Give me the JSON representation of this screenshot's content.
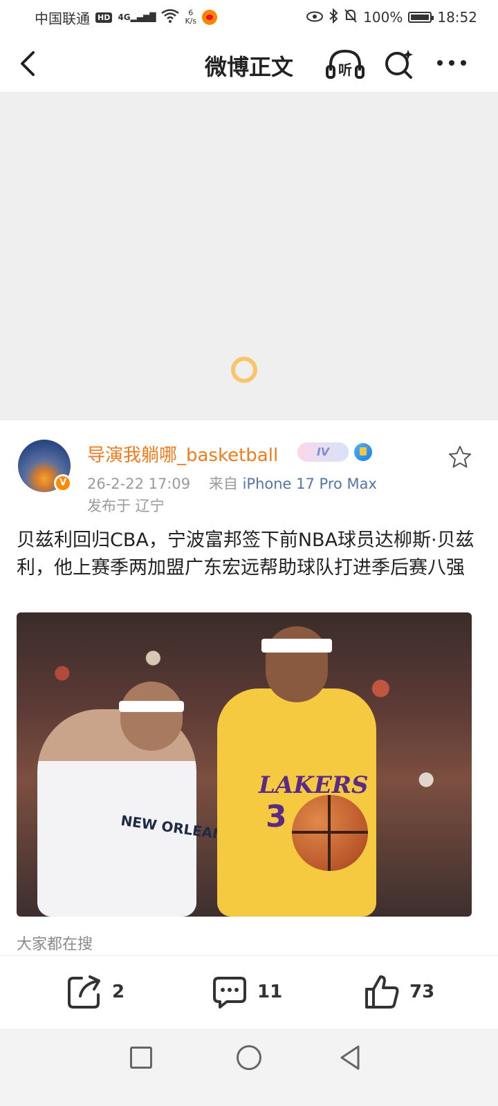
{
  "status_bar": {
    "carrier": "中国联通",
    "hd": "HD",
    "network": "4G",
    "speed_value": "6",
    "speed_unit": "K/s",
    "battery": "100%",
    "time": "18:52"
  },
  "nav": {
    "title": "微博正文",
    "listen_label": "听"
  },
  "post": {
    "username": "导演我躺哪_basketball",
    "level": "IV",
    "verified_badge": "V",
    "timestamp": "26-2-22 17:09",
    "source_prefix": "来自",
    "device": "iPhone 17 Pro Max",
    "location": "发布于 辽宁",
    "content": "贝兹利回归CBA，宁波富邦签下前NBA球员达柳斯·贝兹利，他上赛季两加盟广东宏远帮助球队打进季后赛八强",
    "photo": {
      "jersey_text": "LAKERS",
      "jersey_number": "3",
      "opponent_text": "NEW ORLEANS"
    },
    "search_hint": "大家都在搜"
  },
  "actions": {
    "share_count": "2",
    "comment_count": "11",
    "like_count": "73"
  },
  "colors": {
    "username": "#f07a1c",
    "device": "#5276a8",
    "loader": "#f7c56a"
  }
}
